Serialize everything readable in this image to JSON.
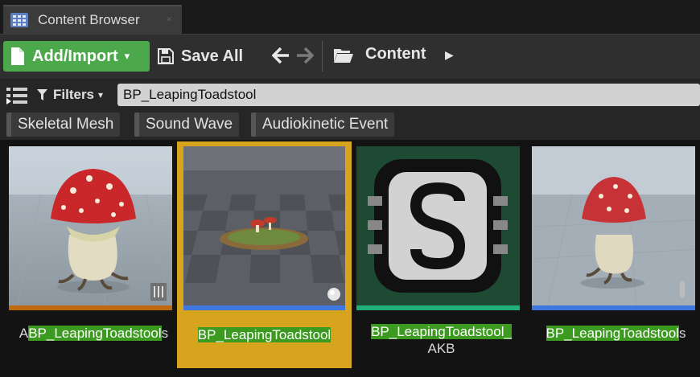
{
  "tab": {
    "title": "Content Browser",
    "close": "×"
  },
  "toolbar": {
    "add_label": "Add/Import",
    "add_caret": "▾",
    "save_label": "Save All",
    "path_label": "Content",
    "path_arrow": "▶"
  },
  "filters": {
    "label": "Filters",
    "caret": "▾"
  },
  "search": {
    "value": "BP_LeapingToadstool"
  },
  "chips": [
    {
      "label": "Skeletal Mesh"
    },
    {
      "label": "Sound Wave"
    },
    {
      "label": "Audiokinetic Event"
    }
  ],
  "assets": [
    {
      "prefix": "A",
      "match": "BP_LeapingToadstool",
      "suffix": "s",
      "type_color": "#c06a10",
      "selected": false
    },
    {
      "prefix": "",
      "match": "BP_LeapingToadstool",
      "suffix": "",
      "type_color": "#3f77e0",
      "selected": true
    },
    {
      "prefix": "",
      "match": "BP_LeapingToadstool_",
      "suffix": "AKB",
      "type_color": "#1fb07a",
      "selected": false
    },
    {
      "prefix": "",
      "match": "BP_LeapingToadstool",
      "suffix": "s",
      "type_color": "#3f77e0",
      "selected": false
    }
  ],
  "colors": {
    "accent_green": "#4ba84b",
    "selection": "#d6a41d",
    "highlight": "#3b9a1f"
  },
  "icons": {
    "tab": "content-browser-grid-icon",
    "add": "new-document-icon",
    "save": "floppy-disk-icon",
    "back": "arrow-left-icon",
    "forward": "arrow-right-icon",
    "folder": "open-folder-icon",
    "sources": "sources-panel-icon",
    "filter": "funnel-icon"
  }
}
